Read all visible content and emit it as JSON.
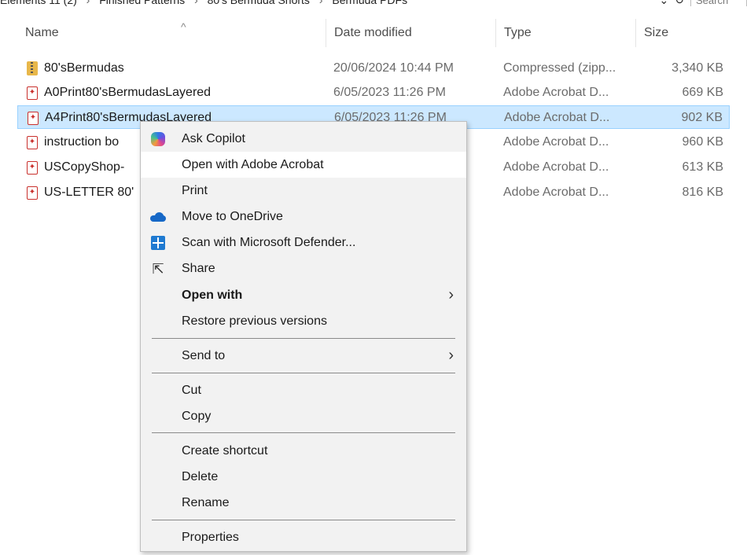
{
  "breadcrumb": {
    "items": [
      "Elements 11 (2)",
      "Finished Patterns",
      "80's Bermuda Shorts",
      "Bermuda PDFs"
    ],
    "search_placeholder": "Search"
  },
  "columns": {
    "name": "Name",
    "date_modified": "Date modified",
    "type": "Type",
    "size": "Size"
  },
  "files": [
    {
      "name": "80'sBermudas",
      "date": "20/06/2024 10:44 PM",
      "type": "Compressed (zipp...",
      "size": "3,340 KB",
      "icon": "zip-folder-icon"
    },
    {
      "name": "A0Print80'sBermudasLayered",
      "date": "6/05/2023 11:26 PM",
      "type": "Adobe Acrobat D...",
      "size": "669 KB",
      "icon": "pdf-file-icon"
    },
    {
      "name": "A4Print80'sBermudasLayered",
      "date": "6/05/2023 11:26 PM",
      "type": "Adobe Acrobat D...",
      "size": "902 KB",
      "icon": "pdf-file-icon"
    },
    {
      "name": "instruction bo",
      "date": "",
      "type": "Adobe Acrobat D...",
      "size": "960 KB",
      "icon": "pdf-file-icon"
    },
    {
      "name": "USCopyShop-",
      "date": "",
      "type": "Adobe Acrobat D...",
      "size": "613 KB",
      "icon": "pdf-file-icon"
    },
    {
      "name": "US-LETTER 80'",
      "date": "",
      "type": "Adobe Acrobat D...",
      "size": "816 KB",
      "icon": "pdf-file-icon"
    }
  ],
  "context_menu": {
    "ask_copilot": "Ask Copilot",
    "open_with_acrobat": "Open with Adobe Acrobat",
    "print": "Print",
    "move_to_onedrive": "Move to OneDrive",
    "scan_defender": "Scan with Microsoft Defender...",
    "share": "Share",
    "open_with": "Open with",
    "restore_versions": "Restore previous versions",
    "send_to": "Send to",
    "cut": "Cut",
    "copy": "Copy",
    "create_shortcut": "Create shortcut",
    "delete": "Delete",
    "rename": "Rename",
    "properties": "Properties"
  },
  "colors": {
    "selection_bg": "#cce8ff",
    "selection_border": "#99d1ff",
    "menu_bg": "#f2f2f2",
    "pdf_red": "#c9302c"
  }
}
